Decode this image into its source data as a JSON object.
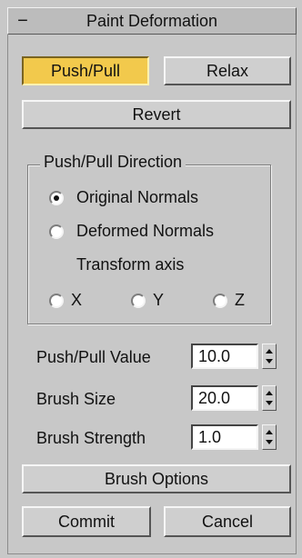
{
  "rollout": {
    "collapse_symbol": "−",
    "title": "Paint Deformation"
  },
  "mode_buttons": [
    {
      "label": "Push/Pull",
      "active": true
    },
    {
      "label": "Relax",
      "active": false
    }
  ],
  "revert_label": "Revert",
  "direction": {
    "group_label": "Push/Pull Direction",
    "options": [
      {
        "label": "Original Normals",
        "selected": true
      },
      {
        "label": "Deformed Normals",
        "selected": false
      }
    ],
    "transform_axis_label": "Transform axis",
    "axes": [
      {
        "label": "X",
        "selected": false
      },
      {
        "label": "Y",
        "selected": false
      },
      {
        "label": "Z",
        "selected": false
      }
    ]
  },
  "params": [
    {
      "label": "Push/Pull Value",
      "value": "10.0"
    },
    {
      "label": "Brush Size",
      "value": "20.0"
    },
    {
      "label": "Brush Strength",
      "value": "1.0"
    }
  ],
  "brush_options_label": "Brush Options",
  "commit_label": "Commit",
  "cancel_label": "Cancel",
  "colors": {
    "panel_bg": "#c8c8c8",
    "active_button": "#f2c94c",
    "field_bg": "#ffffff"
  }
}
